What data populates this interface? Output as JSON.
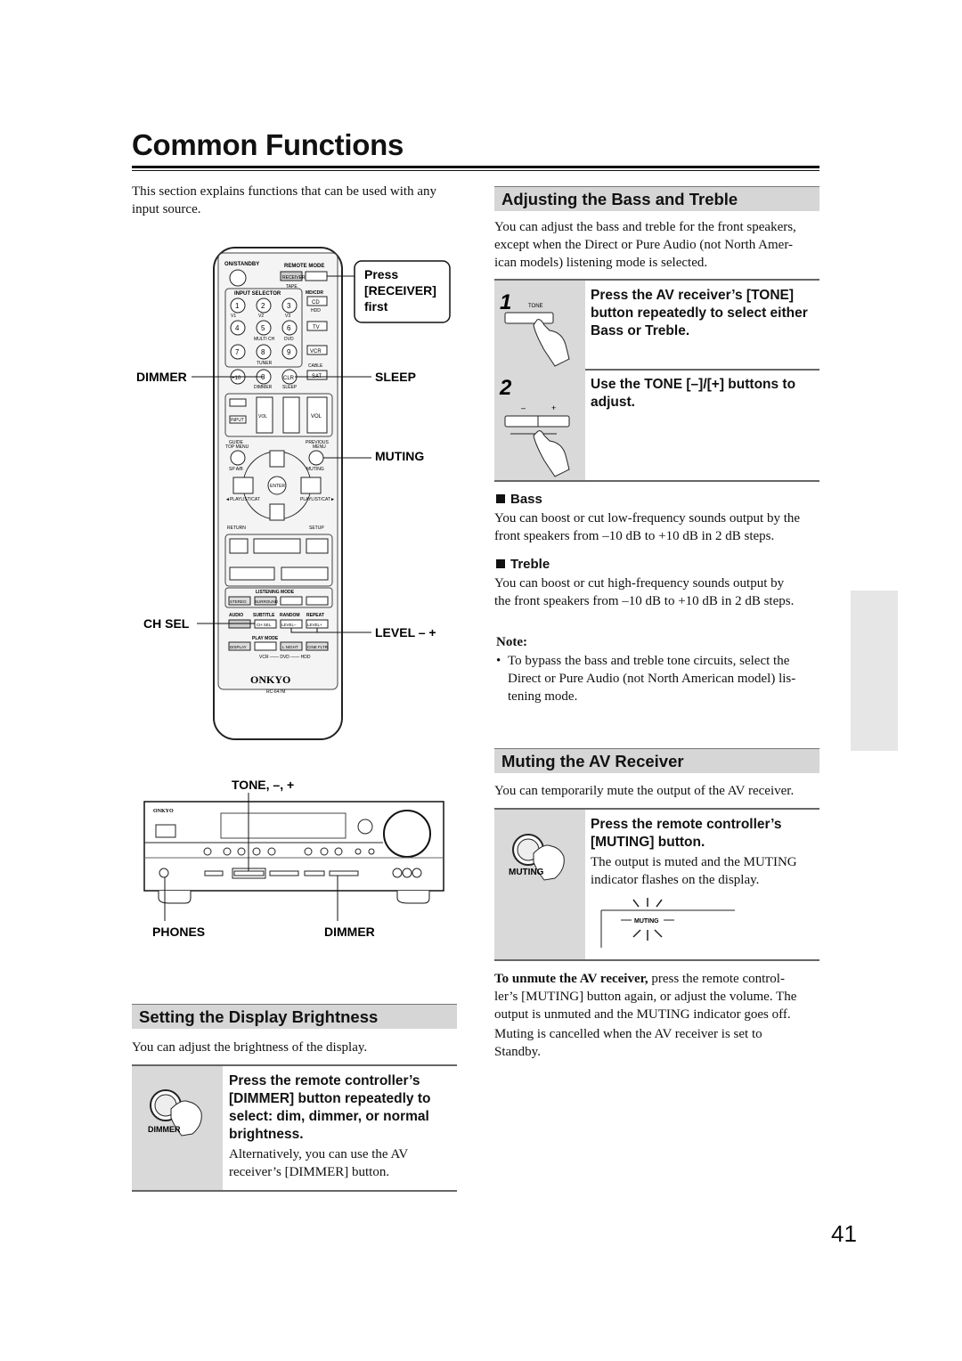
{
  "page": {
    "title": "Common Functions",
    "page_number": "41"
  },
  "intro": {
    "line1": "This section explains functions that can be used with any",
    "line2": "input source."
  },
  "remote": {
    "callouts": {
      "press_line1": "Press",
      "press_line2": "[RECEIVER]",
      "press_line3": "first",
      "dimmer": "DIMMER",
      "sleep": "SLEEP",
      "muting": "MUTING",
      "ch_sel": "CH SEL",
      "level": "LEVEL – +"
    },
    "labels": {
      "on_standby": "ON/STANDBY",
      "remote_mode": "REMOTE MODE",
      "receiver": "RECEIVER",
      "tape": "TAPE",
      "input_selector": "INPUT SELECTOR",
      "md_cdr": "MD/CDR",
      "cd": "CD",
      "hdd": "HDD",
      "tv": "TV",
      "vcr": "VCR",
      "cable": "CABLE",
      "sat": "SAT",
      "multi_ch": "MULTI CH",
      "dvd": "DVD",
      "tuner": "TUNER",
      "dimmer": "DIMMER",
      "sleep": "SLEEP",
      "vol": "VOL",
      "input": "INPUT",
      "guide": "GUIDE",
      "top_menu": "TOP MENU",
      "previous": "PREVIOUS",
      "menu": "MENU",
      "sp_ab": "SP A/B",
      "muting": "MUTING",
      "enter": "ENTER",
      "playlist_l": "◄PLAYLIST/CAT",
      "playlist_r": "PLAYLIST/CAT►",
      "return": "RETURN",
      "setup": "SETUP",
      "listening_mode": "LISTENING MODE",
      "stereo": "STEREO",
      "surround": "SURROUND",
      "audio": "AUDIO",
      "subtitle": "SUBTITLE",
      "random": "RANDOM",
      "repeat": "REPEAT",
      "ch_sel": "CH SEL",
      "level_minus": "LEVEL–",
      "level_plus": "LEVEL+",
      "play_mode": "PLAY MODE",
      "display": "DISPLAY",
      "l_night": "L NIGHT",
      "cine_fltr": "CINE FLTR",
      "vcr_dvd_hdd": "VCR —— DVD —— HDD",
      "brand": "ONKYO",
      "model": "RC-647M",
      "digits": [
        "1",
        "2",
        "3",
        "4",
        "5",
        "6",
        "7",
        "8",
        "9",
        "+10",
        "0",
        "CLR"
      ],
      "sub_digits": [
        "V1",
        "V2",
        "V3"
      ]
    }
  },
  "receiver_fig": {
    "tone_label": "TONE, –, +",
    "phones_label": "PHONES",
    "dimmer_label": "DIMMER",
    "brand": "ONKYO"
  },
  "display_brightness": {
    "heading": "Setting the Display Brightness",
    "text": "You can adjust the brightness of the display.",
    "step": {
      "icon_label": "DIMMER",
      "bold_lines": [
        "Press the remote controller’s",
        "[DIMMER] button repeatedly to",
        "select: dim, dimmer, or normal",
        "brightness."
      ],
      "note_lines": [
        "Alternatively, you can use the AV",
        "receiver’s [DIMMER] button."
      ]
    }
  },
  "bass_treble": {
    "heading": "Adjusting the Bass and Treble",
    "intro_lines": [
      "You can adjust the bass and treble for the front speakers,",
      "except when the Direct or Pure Audio (not North Amer-",
      "ican models) listening mode is selected."
    ],
    "steps": [
      {
        "number": "1",
        "icon_label": "TONE",
        "lines": [
          "Press the AV receiver’s [TONE]",
          "button repeatedly to select either",
          "Bass or Treble."
        ]
      },
      {
        "number": "2",
        "icon_minus": "–",
        "icon_plus": "+",
        "lines": [
          "Use the TONE [–]/[+] buttons to",
          "adjust."
        ]
      }
    ],
    "bass": {
      "heading": "Bass",
      "lines": [
        "You can boost or cut low-frequency sounds output by the",
        "front speakers from –10 dB to +10 dB in 2 dB steps."
      ]
    },
    "treble": {
      "heading": "Treble",
      "lines": [
        "You can boost or cut high-frequency sounds output by",
        "the front speakers from –10 dB to +10 dB in 2 dB steps."
      ]
    },
    "note": {
      "heading": "Note:",
      "bullet": "•",
      "lines": [
        "To bypass the bass and treble tone circuits, select the",
        "Direct or Pure Audio (not North American model) lis-",
        "tening mode."
      ]
    }
  },
  "muting": {
    "heading": "Muting the AV Receiver",
    "intro": "You can temporarily mute the output of the AV receiver.",
    "step": {
      "icon_label": "MUTING",
      "bold_lines": [
        "Press the remote controller’s",
        "[MUTING] button."
      ],
      "lines": [
        "The output is muted and the MUTING",
        "indicator flashes on the display."
      ],
      "display_indicator": "MUTING"
    },
    "unmute_bold": "To unmute the AV receiver,",
    "unmute_lines": [
      " press the remote control-",
      "ler’s [MUTING] button again, or adjust the volume. The",
      "output is unmuted and the MUTING indicator goes off.",
      "Muting is cancelled when the AV receiver is set to",
      "Standby."
    ]
  },
  "colors": {
    "header_bg": "#d6d6d6",
    "step_gray": "#d9d9d9",
    "side_tab": "#e6e6e6"
  }
}
